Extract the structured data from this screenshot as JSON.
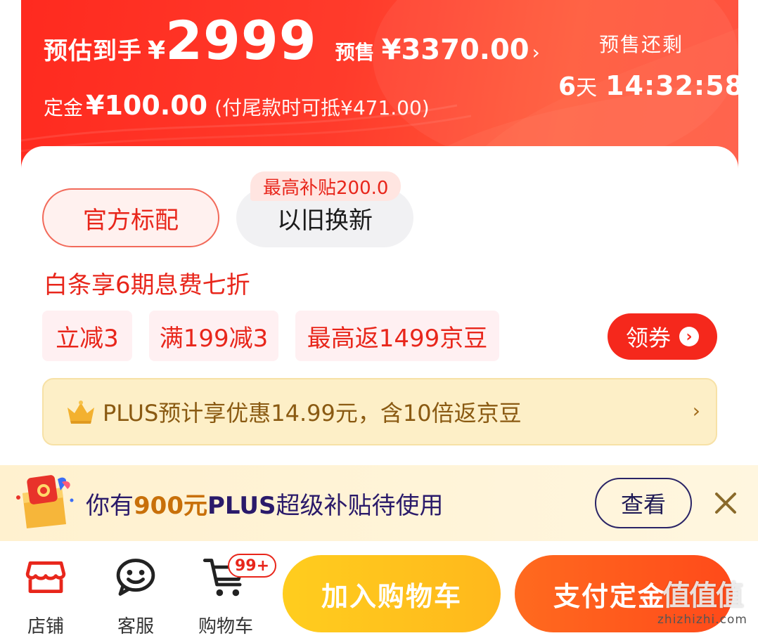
{
  "price_banner": {
    "estimated_label": "预估到手",
    "yen_symbol": "¥",
    "estimated_price": "2999",
    "presale_label": "预售",
    "presale_price": "¥3370.00",
    "presale_arrow": "›",
    "deposit_label": "定金",
    "deposit_price": "¥100.00",
    "deposit_note": "(付尾款时可抵¥471.00)",
    "countdown_label": "预售还剩",
    "countdown_days": "6",
    "countdown_day_unit": "天",
    "countdown_time": "14:32:58"
  },
  "options": {
    "spec_chip": "官方标配",
    "trade_in_chip": "以旧换新",
    "subsidy_tag": "最高补贴200.0"
  },
  "promotions": {
    "baitiao": "白条享6期息费七折",
    "tags": [
      "立减3",
      "满199减3",
      "最高返1499京豆"
    ],
    "coupon_button": "领券",
    "coupon_arrow": "›",
    "plus_text": "PLUS预计享优惠14.99元，含10倍返京豆",
    "plus_arrow": "›"
  },
  "notice": {
    "prefix": "你有",
    "amount": "900元",
    "plus": "PLUS",
    "suffix": "超级补贴待使用",
    "view_button": "查看"
  },
  "bottom_nav": {
    "shop_label": "店铺",
    "service_label": "客服",
    "cart_label": "购物车",
    "cart_badge": "99+",
    "add_to_cart": "加入购物车",
    "pay_deposit": "支付定金"
  },
  "watermark": {
    "main": "值值值",
    "sub": "zhizhizhi.com"
  },
  "colors": {
    "brand_red": "#f5281c",
    "banner_red": "#ff3b2b",
    "cart_yellow": "#ffc21d",
    "pay_orange": "#ff5a1c",
    "plus_gold": "#fdefc7"
  },
  "icons": [
    "shop-icon",
    "service-icon",
    "cart-icon",
    "crown-icon",
    "gift-icon",
    "close-icon"
  ]
}
